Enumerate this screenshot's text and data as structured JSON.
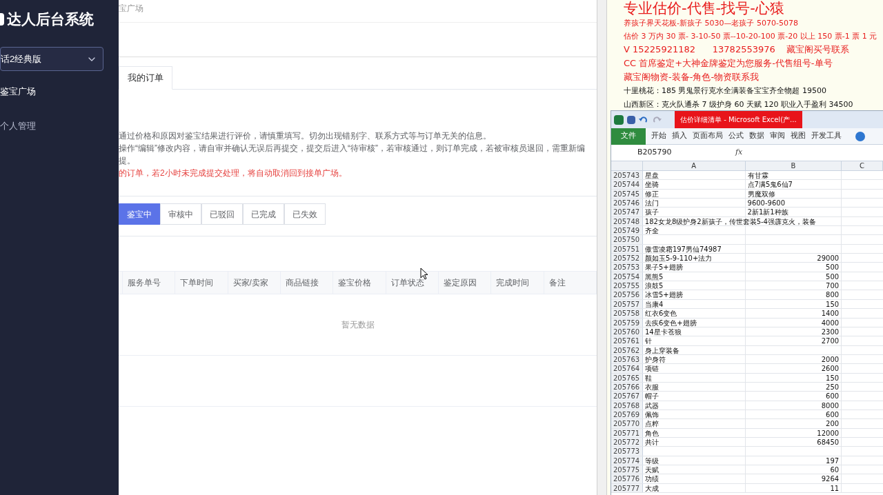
{
  "sidebar": {
    "title": "达人后台系统",
    "game_select": "话2经典版",
    "items": [
      {
        "label": "鉴宝广场",
        "selected": true
      },
      {
        "label": "个人管理",
        "selected": false
      }
    ]
  },
  "breadcrumb": "宝广场",
  "tabs": [
    {
      "label": "我的订单",
      "selected": true
    }
  ],
  "notices": [
    {
      "text": "通过价格和原因对鉴宝结果进行评价，请慎重填写。切勿出现错别字、联系方式等与订单无关的信息。",
      "kind": "normal"
    },
    {
      "text": "操作“编辑”修改内容，请自审并确认无误后再提交，提交后进入“待审核”，若审核通过，则订单完成，若被审核员退回，需重新编",
      "kind": "normal"
    },
    {
      "text": "提。",
      "kind": "normal"
    },
    {
      "text": "的订单，若2小时未完成提交处理，将自动取消回到接单广场。",
      "kind": "warning"
    }
  ],
  "status_filters": [
    {
      "label": "鉴宝中",
      "selected": true
    },
    {
      "label": "审核中",
      "selected": false
    },
    {
      "label": "已驳回",
      "selected": false
    },
    {
      "label": "已完成",
      "selected": false
    },
    {
      "label": "已失效",
      "selected": false
    }
  ],
  "table": {
    "columns": [
      "服务单号",
      "下单时间",
      "买家/卖家",
      "商品链接",
      "鉴宝价格",
      "订单状态",
      "鉴定原因",
      "完成时间",
      "备注"
    ],
    "empty_text": "暂无数据"
  },
  "document": {
    "lines": [
      {
        "text": "专业估价-代售-找号-心猿",
        "kind": "headline"
      },
      {
        "text": "养孩子界天花板-新孩子 5030—老孩子 5070-5078",
        "kind": "red"
      },
      {
        "text": "估价 3 万内 30 票- 3-10-50 票--10-20-100 票-20 以上 150 票-1 票 1 元",
        "kind": "red"
      },
      {
        "text": "V 15225921182      13782553976    藏宝阁买号联系",
        "kind": "red-large"
      },
      {
        "text": "CC 首席鉴定+大神金牌鉴定为您服务-代售组号-单号",
        "kind": "red-large"
      },
      {
        "text": "藏宝阁物资-装备-角色-物资联系我",
        "kind": "red-large"
      },
      {
        "text": "十里桃花：185 男鬼景行克水全满装备宝宝齐全物超 19500",
        "kind": "black"
      },
      {
        "text": "山西新区：克火队通杀 7 级护身 60 天赋 120 职业入手盈利 34500",
        "kind": "black"
      }
    ]
  },
  "excel": {
    "title": "估价详细清单 - Microsoft Excel(产...",
    "file_tab": "文件",
    "ribbon_tabs": [
      "开始",
      "插入",
      "页面布局",
      "公式",
      "数据",
      "审阅",
      "视图",
      "开发工具"
    ],
    "name_box": "B205790",
    "formula_label": "fx",
    "columns": [
      "A",
      "B",
      "C"
    ],
    "rows": [
      {
        "num": "205743",
        "a": "星盘",
        "b": "有甘霖"
      },
      {
        "num": "205744",
        "a": "坐骑",
        "b": "点7满5鬼6仙7"
      },
      {
        "num": "205745",
        "a": "修正",
        "b": "男魔双修"
      },
      {
        "num": "205746",
        "a": "法门",
        "b": "9600-9600"
      },
      {
        "num": "205747",
        "a": "孩子",
        "b": "2新1新1种族"
      },
      {
        "num": "205748",
        "a": "182女龙8级护身2新孩子，传世套装5-4强霹克火，装备",
        "b": ""
      },
      {
        "num": "205749",
        "a": "齐全",
        "b": ""
      },
      {
        "num": "205750",
        "a": "",
        "b": ""
      },
      {
        "num": "205751",
        "a": "傲雪凌霜197男仙74987",
        "b": ""
      },
      {
        "num": "205752",
        "a": "颜如玉5-9-110+法力",
        "b": "29000"
      },
      {
        "num": "205753",
        "a": "果子5+翅膀",
        "b": "500"
      },
      {
        "num": "205754",
        "a": "黑熊5",
        "b": "500"
      },
      {
        "num": "205755",
        "a": "浪鼓5",
        "b": "700"
      },
      {
        "num": "205756",
        "a": "冰雪5+翅膀",
        "b": "800"
      },
      {
        "num": "205757",
        "a": "当康4",
        "b": "150"
      },
      {
        "num": "205758",
        "a": "红衣6变色",
        "b": "1400"
      },
      {
        "num": "205759",
        "a": "去疾6变色+翅膀",
        "b": "4000"
      },
      {
        "num": "205760",
        "a": "14星卡苍狼",
        "b": "2300"
      },
      {
        "num": "205761",
        "a": "针",
        "b": "2700"
      },
      {
        "num": "205762",
        "a": "身上穿装备",
        "b": ""
      },
      {
        "num": "205763",
        "a": "护身符",
        "b": "2000"
      },
      {
        "num": "205764",
        "a": "项链",
        "b": "2600"
      },
      {
        "num": "205765",
        "a": "鞋",
        "b": "150"
      },
      {
        "num": "205766",
        "a": "衣服",
        "b": "250"
      },
      {
        "num": "205767",
        "a": "帽子",
        "b": "600"
      },
      {
        "num": "205768",
        "a": "武器",
        "b": "8000"
      },
      {
        "num": "205769",
        "a": "佩饰",
        "b": "600"
      },
      {
        "num": "205770",
        "a": "点粹",
        "b": "200"
      },
      {
        "num": "205771",
        "a": "角色",
        "b": "12000"
      },
      {
        "num": "205772",
        "a": "共计",
        "b": "68450"
      },
      {
        "num": "205773",
        "a": "",
        "b": ""
      },
      {
        "num": "205774",
        "a": "等级",
        "b": "197"
      },
      {
        "num": "205775",
        "a": "天赋",
        "b": "60"
      },
      {
        "num": "205776",
        "a": "功绩",
        "b": "9264"
      },
      {
        "num": "205777",
        "a": "大成",
        "b": "11"
      }
    ]
  }
}
